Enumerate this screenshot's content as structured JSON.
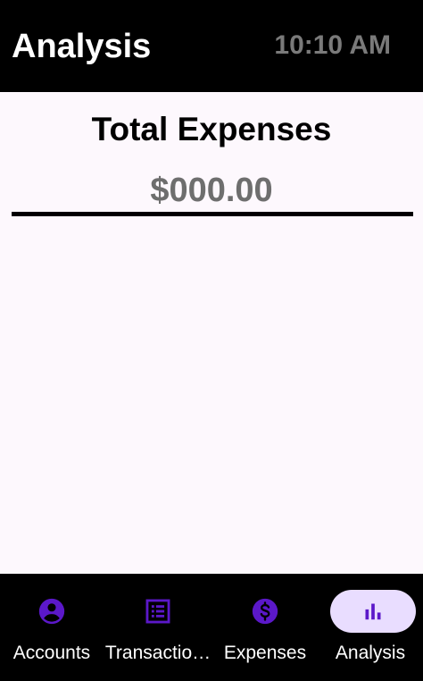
{
  "header": {
    "title": "Analysis",
    "time": "10:10 AM"
  },
  "summary": {
    "heading": "Total Expenses",
    "amount": "$000.00"
  },
  "nav": {
    "items": [
      {
        "label": "Accounts",
        "icon": "account-circle-icon",
        "active": false
      },
      {
        "label": "Transactio…",
        "icon": "list-icon",
        "active": false
      },
      {
        "label": "Expenses",
        "icon": "dollar-circle-icon",
        "active": false
      },
      {
        "label": "Analysis",
        "icon": "bar-chart-icon",
        "active": true
      }
    ]
  },
  "colors": {
    "icon_color": "#5b18c9",
    "active_pill": "#e9ddff",
    "bars_background": "#000000",
    "content_background": "#fdf8fd"
  }
}
